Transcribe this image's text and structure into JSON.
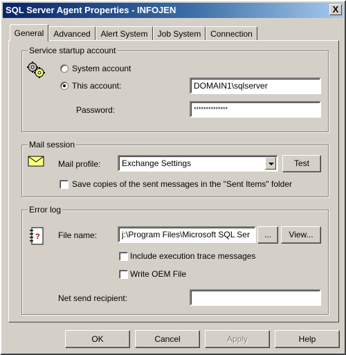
{
  "window": {
    "title": "SQL Server Agent Properties - INFOJEN",
    "close_label": "X"
  },
  "tabs": [
    {
      "label": "General",
      "active": true
    },
    {
      "label": "Advanced",
      "active": false
    },
    {
      "label": "Alert System",
      "active": false
    },
    {
      "label": "Job System",
      "active": false
    },
    {
      "label": "Connection",
      "active": false
    }
  ],
  "service_startup": {
    "legend": "Service startup account",
    "system_account_label": "System account",
    "this_account_label": "This account:",
    "selected": "this_account",
    "account_value": "DOMAIN1\\sqlserver",
    "password_label": "Password:",
    "password_value": "**************",
    "icon": "gears-icon"
  },
  "mail_session": {
    "legend": "Mail session",
    "mail_profile_label": "Mail profile:",
    "mail_profile_value": "Exchange Settings",
    "test_button": "Test",
    "save_copies_label": "Save copies of the sent messages in the \"Sent Items\" folder",
    "save_copies_checked": false,
    "icon": "envelope-icon"
  },
  "error_log": {
    "legend": "Error log",
    "file_name_label": "File name:",
    "file_name_value": "j:\\Program Files\\Microsoft SQL Ser",
    "browse_button": "...",
    "view_button": "View...",
    "include_trace_label": "Include execution trace messages",
    "include_trace_checked": false,
    "write_oem_label": "Write OEM File",
    "write_oem_checked": false,
    "net_send_label": "Net send recipient:",
    "net_send_value": "",
    "icon": "log-notebook-icon"
  },
  "buttons": {
    "ok": "OK",
    "cancel": "Cancel",
    "apply": "Apply",
    "help": "Help"
  },
  "colors": {
    "face": "#d4d0c8",
    "title_start": "#0a246a",
    "title_end": "#a6caf0"
  }
}
